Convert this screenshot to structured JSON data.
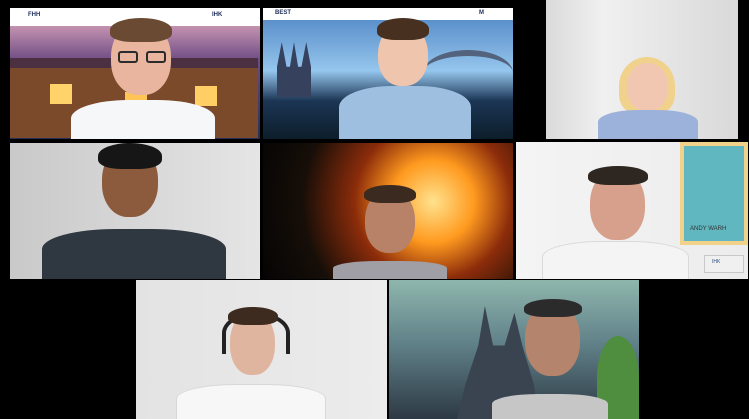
{
  "logos": {
    "tile1_left": "FHH",
    "tile1_right": "IHK",
    "tile2_center": "BEST",
    "tile2_right": "M"
  },
  "poster_text": "ANDY WARH",
  "sign_text": "IHK",
  "colors": {
    "background": "#000000",
    "night_sky": "#2e3a63",
    "sunset": "#d88aa0",
    "blue_hour": "#183c78",
    "fire_orange": "#ff9a1f",
    "room_white": "#f1f1f1",
    "cyan_poster": "#60b7bf"
  }
}
